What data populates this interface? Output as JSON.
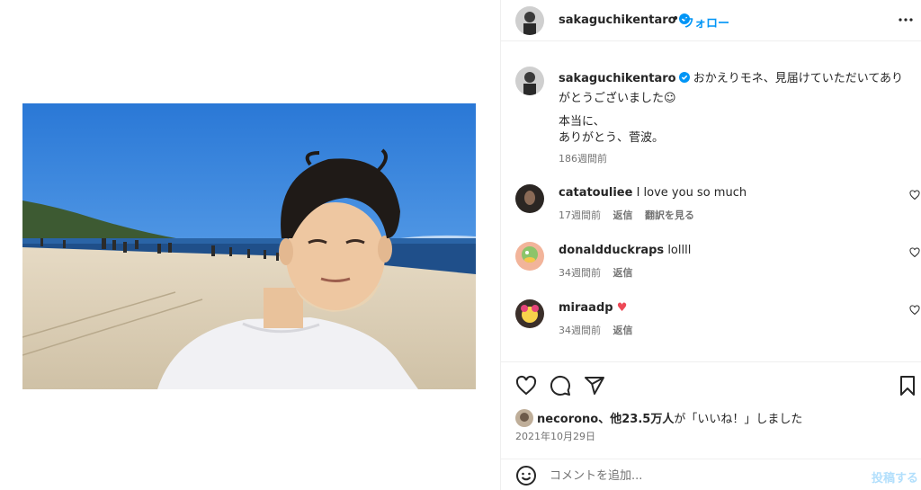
{
  "header": {
    "username": "sakaguchikentaro",
    "separator": "•",
    "follow_label": "フォロー"
  },
  "caption": {
    "username": "sakaguchikentaro",
    "text_line1": "おかえりモネ、見届けていただいてありがとうございました☺",
    "text_line2": "本当に、\nありがとう、菅波。",
    "time": "186週間前"
  },
  "comments": [
    {
      "username": "catatouliee",
      "text": "I love you so much",
      "time": "17週間前",
      "reply_label": "返信",
      "translate_label": "翻訳を見る"
    },
    {
      "username": "donaldduckraps",
      "text": "lollll",
      "time": "34週間前",
      "reply_label": "返信",
      "translate_label": ""
    },
    {
      "username": "miraadp",
      "text": "♥",
      "time": "34週間前",
      "reply_label": "返信",
      "translate_label": ""
    }
  ],
  "likes": {
    "liker": "necorono",
    "others": "、他23.5万人",
    "suffix": "が「いいね！」しました"
  },
  "date": "2021年10月29日",
  "add_comment": {
    "placeholder": "コメントを追加...",
    "post_label": "投稿する"
  },
  "icons": {
    "verified": "verified-badge-icon",
    "more": "more-options-icon",
    "like": "heart-icon",
    "comment": "comment-icon",
    "share": "share-icon",
    "save": "bookmark-icon",
    "emoji": "emoji-icon"
  },
  "colors": {
    "link_blue": "#0095f6",
    "post_disabled": "#b2dffc",
    "heart_red": "#ed4956",
    "muted": "#737373"
  }
}
